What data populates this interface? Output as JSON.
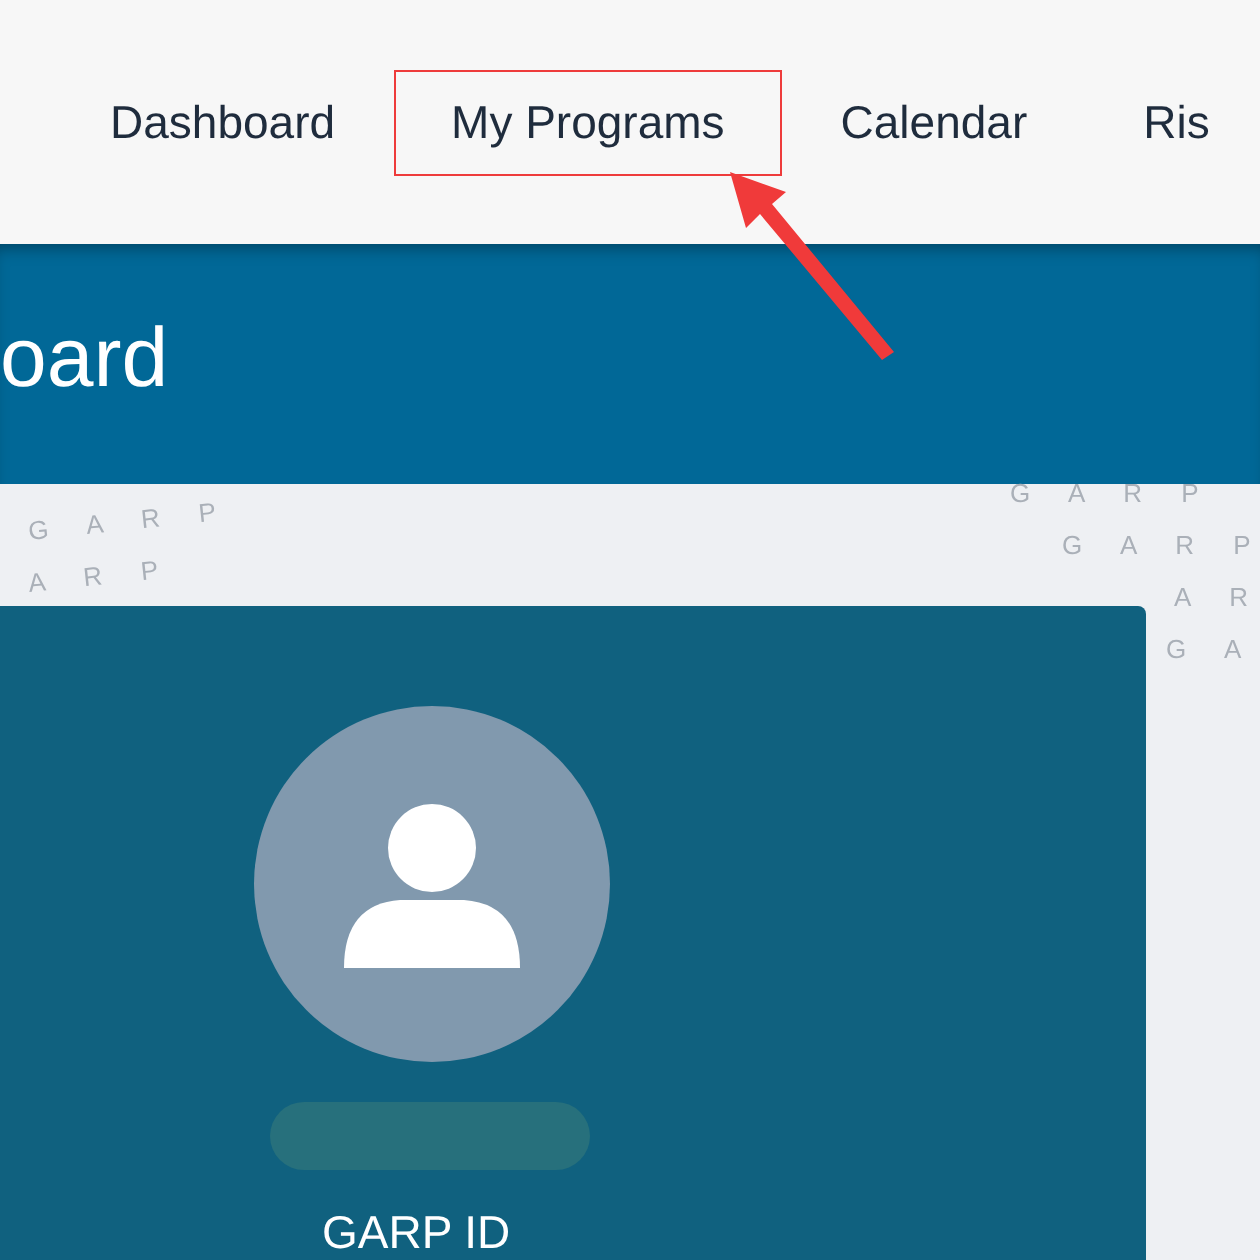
{
  "nav": {
    "items": [
      {
        "label": "Dashboard",
        "highlighted": false
      },
      {
        "label": "My Programs",
        "highlighted": true
      },
      {
        "label": "Calendar",
        "highlighted": false
      },
      {
        "label": "Ris",
        "highlighted": false
      }
    ]
  },
  "banner": {
    "title": "oard"
  },
  "pattern": {
    "left": [
      "G A R P",
      "A R P"
    ],
    "right": [
      "G A R P",
      "G A R P",
      "A R",
      "G A"
    ]
  },
  "profile": {
    "id_label": "GARP ID"
  }
}
